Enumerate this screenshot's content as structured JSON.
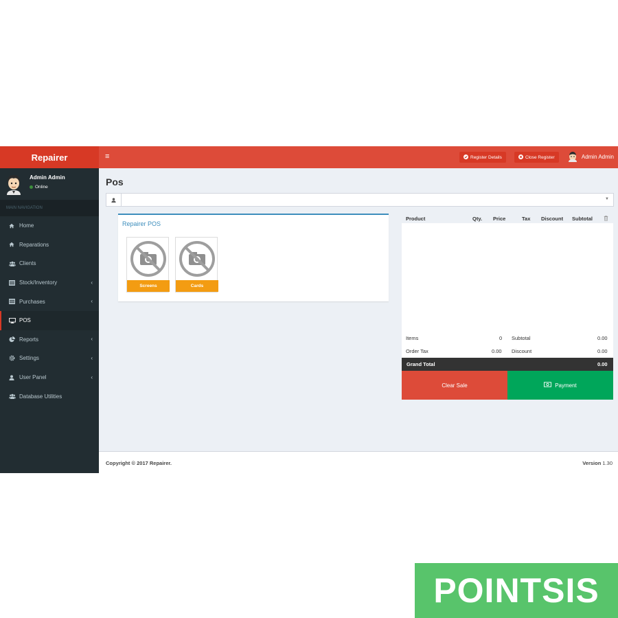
{
  "app": {
    "brand": "Repairer"
  },
  "sidebar": {
    "user": {
      "name": "Admin Admin",
      "status": "Online"
    },
    "nav_header": "MAIN NAVIGATION",
    "items": [
      {
        "label": "Home",
        "icon": "home-icon"
      },
      {
        "label": "Reparations",
        "icon": "home-icon"
      },
      {
        "label": "Clients",
        "icon": "users-icon"
      },
      {
        "label": "Stock/Inventory",
        "icon": "list-icon",
        "chevron": "‹"
      },
      {
        "label": "Purchases",
        "icon": "list-icon",
        "chevron": "‹"
      },
      {
        "label": "POS",
        "icon": "monitor-icon",
        "active": true
      },
      {
        "label": "Reports",
        "icon": "pie-chart-icon",
        "chevron": "‹"
      },
      {
        "label": "Settings",
        "icon": "gear-icon",
        "chevron": "‹"
      },
      {
        "label": "User Panel",
        "icon": "user-icon",
        "chevron": "‹"
      },
      {
        "label": "Database Utilities",
        "icon": "users-icon"
      }
    ]
  },
  "topbar": {
    "menu_icon": "≡",
    "register_details": "Register Details",
    "close_register": "Close Register",
    "user_name": "Admin Admin"
  },
  "page": {
    "title": "Pos",
    "client_caret": "▼"
  },
  "pos": {
    "title": "Repairer POS",
    "categories": [
      {
        "label": "Screens"
      },
      {
        "label": "Cards"
      }
    ]
  },
  "order": {
    "columns": [
      "Product",
      "Qty.",
      "Price",
      "Tax",
      "Discount",
      "Subtotal"
    ],
    "items_label": "Items",
    "items_value": "0",
    "subtotal_label": "Subtotal",
    "subtotal_value": "0.00",
    "order_tax_label": "Order Tax",
    "order_tax_value": "0.00",
    "discount_label": "Discount",
    "discount_value": "0.00",
    "grand_total_label": "Grand Total",
    "grand_total_value": "0.00",
    "clear_sale": "Clear Sale",
    "payment": "Payment"
  },
  "footer": {
    "copyright": "Copyright © 2017 Repairer.",
    "version_label": "Version",
    "version_value": "1.30"
  },
  "watermark": "POINTSIS",
  "colors": {
    "brand_red": "#dd4b39",
    "sidebar_dark": "#222d32",
    "category_orange": "#f39c12",
    "payment_green": "#00a65a",
    "accent_blue": "#3c8dbc"
  }
}
